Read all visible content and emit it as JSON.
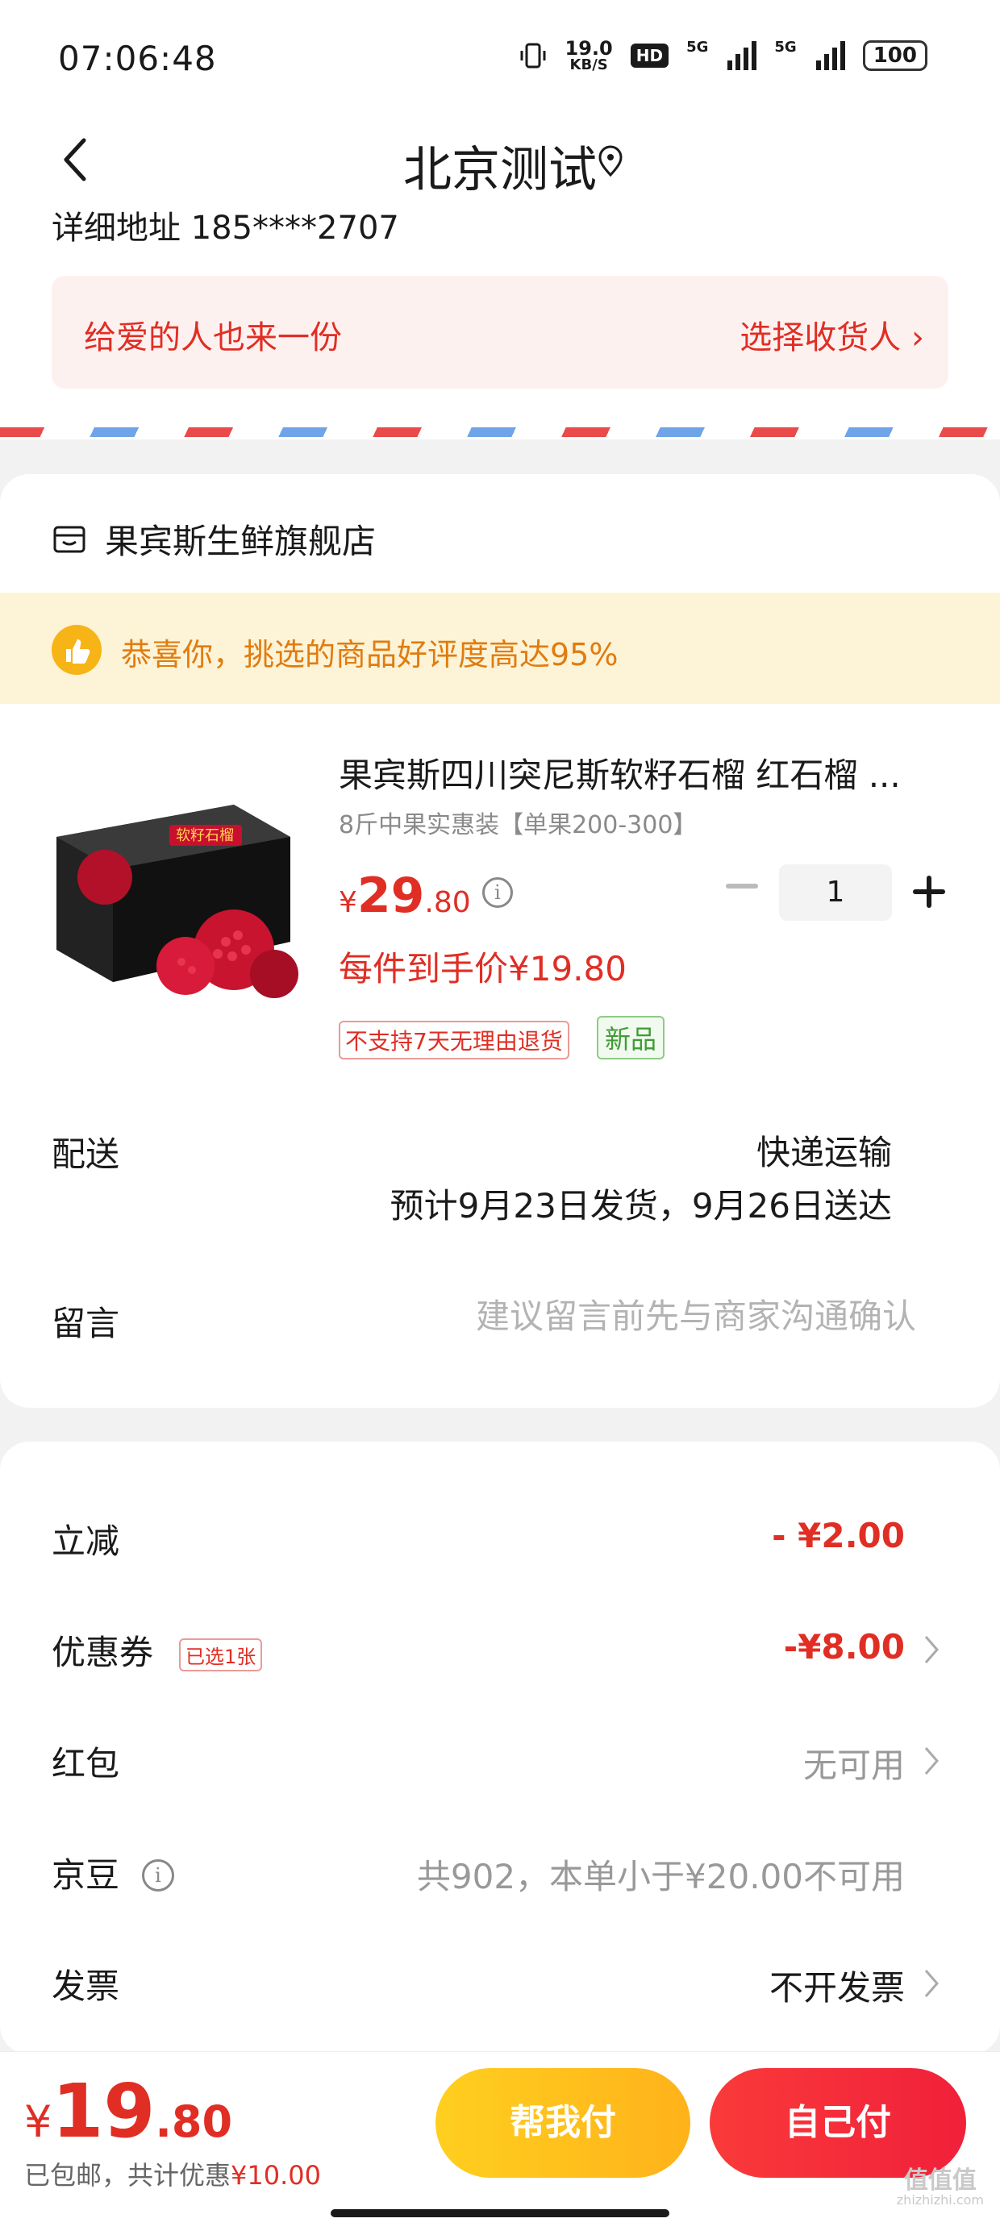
{
  "status_bar": {
    "time": "07:06:48",
    "net_speed": "19.0",
    "net_unit": "KB/S",
    "hd": "HD",
    "sim1": "5G",
    "sim2": "5G",
    "battery": "100"
  },
  "nav": {
    "title": "北京测试"
  },
  "address": {
    "partial_line": "详细地址 185****2707",
    "gift_text": "给爱的人也来一份",
    "gift_action": "选择收货人 ›"
  },
  "shop": {
    "store_name": "果宾斯生鲜旗舰店",
    "praise": "恭喜你，挑选的商品好评度高达95%",
    "product": {
      "title": "果宾斯四川突尼斯软籽石榴 红石榴 ...",
      "spec": "8斤中果实惠装【单果200-300】",
      "price_symbol": "¥",
      "price_int": "29",
      "price_dec": ".80",
      "quantity": "1",
      "net_price": "每件到手价¥19.80",
      "tag_no_return": "不支持7天无理由退货",
      "tag_new": "新品"
    },
    "shipping": {
      "label": "配送",
      "method": "快递运输",
      "eta": "预计9月23日发货，9月26日送达"
    },
    "message": {
      "label": "留言",
      "placeholder": "建议留言前先与商家沟通确认"
    }
  },
  "discounts": {
    "instant": {
      "label": "立减",
      "value": "- ¥2.00"
    },
    "coupon": {
      "label": "优惠券",
      "tag": "已选1张",
      "value": "-¥8.00"
    },
    "redpacket": {
      "label": "红包",
      "value": "无可用"
    },
    "jingdou": {
      "label": "京豆",
      "value": "共902，本单小于¥20.00不可用"
    },
    "invoice": {
      "label": "发票",
      "value": "不开发票"
    }
  },
  "bottom": {
    "total_symbol": "¥",
    "total_int": "19",
    "total_dec": ".80",
    "note_prefix": "已包邮，共计优惠",
    "note_amount": "¥10.00",
    "help_pay": "帮我付",
    "self_pay": "自己付"
  },
  "watermark": {
    "main": "值值值",
    "sub": "zhizhizhi.com"
  },
  "colors": {
    "accent_red": "#e02e24",
    "help_pay_yellow": "#ffb21a",
    "self_pay_red": "#f0203a",
    "praise_bg": "#fdf3d6"
  },
  "icons": [
    "back-icon",
    "location-pin-icon",
    "store-icon",
    "thumbs-up-icon",
    "info-icon",
    "minus-icon",
    "plus-icon",
    "chevron-right-icon"
  ]
}
